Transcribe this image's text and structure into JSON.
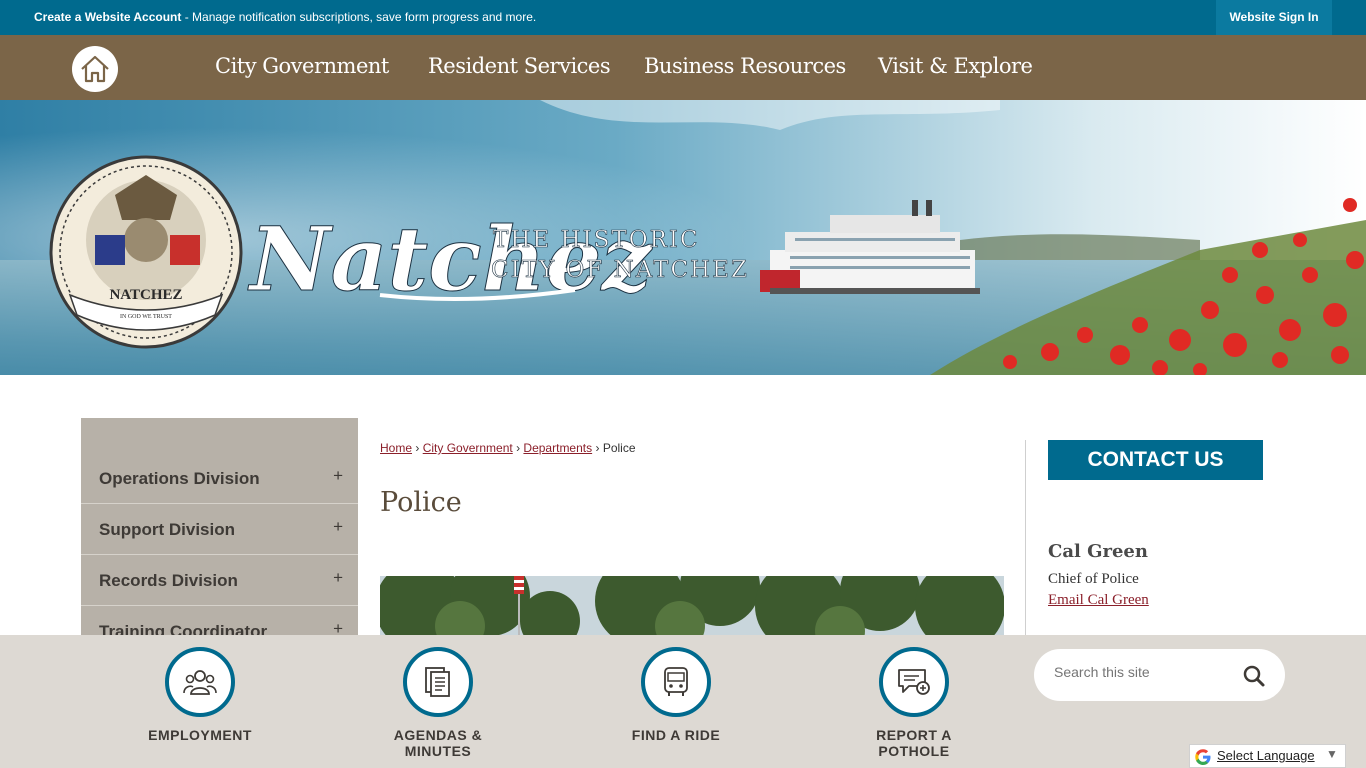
{
  "topbar": {
    "account_link": "Create a Website Account",
    "account_desc": " - Manage notification subscriptions, save form progress and more.",
    "signin": "Website Sign In"
  },
  "nav": {
    "home_icon": "home-icon",
    "items": [
      {
        "label": "City Government"
      },
      {
        "label": "Resident Services"
      },
      {
        "label": "Business Resources"
      },
      {
        "label": "Visit & Explore"
      }
    ]
  },
  "banner": {
    "logo_word": "Natchez",
    "tagline_1": "THE HISTORIC",
    "tagline_2": "CITY OF NATCHEZ",
    "seal_name": "NATCHEZ",
    "seal_motto": "IN GOD WE TRUST"
  },
  "sidenav": {
    "items": [
      {
        "label": "Operations Division",
        "icon": "+"
      },
      {
        "label": "Support Division",
        "icon": "+"
      },
      {
        "label": "Records Division",
        "icon": "+"
      },
      {
        "label": "Training Coordinator",
        "icon": "+"
      }
    ]
  },
  "breadcrumb": {
    "home": "Home",
    "city_gov": "City Government",
    "departments": "Departments",
    "current": "Police",
    "separator": "›"
  },
  "page": {
    "title": "Police"
  },
  "contact": {
    "button": "CONTACT US",
    "name": "Cal Green",
    "title": "Chief of Police",
    "email_link": "Email Cal Green"
  },
  "footer": {
    "quick_links": [
      {
        "label": "EMPLOYMENT",
        "icon": "people-icon"
      },
      {
        "label": "AGENDAS &",
        "label2": "MINUTES",
        "icon": "documents-icon"
      },
      {
        "label": "FIND A RIDE",
        "icon": "bus-icon"
      },
      {
        "label": "REPORT A",
        "label2": "POTHOLE",
        "icon": "report-chat-icon"
      }
    ],
    "search_placeholder": "Search this site",
    "translate": "Select Language",
    "translate_arrow": "▼"
  },
  "colors": {
    "topbar": "#006a8e",
    "nav": "#7b6548",
    "accent_link": "#8b1f2a",
    "sidenav": "#b7b1a8",
    "footer": "#ddd9d3"
  }
}
